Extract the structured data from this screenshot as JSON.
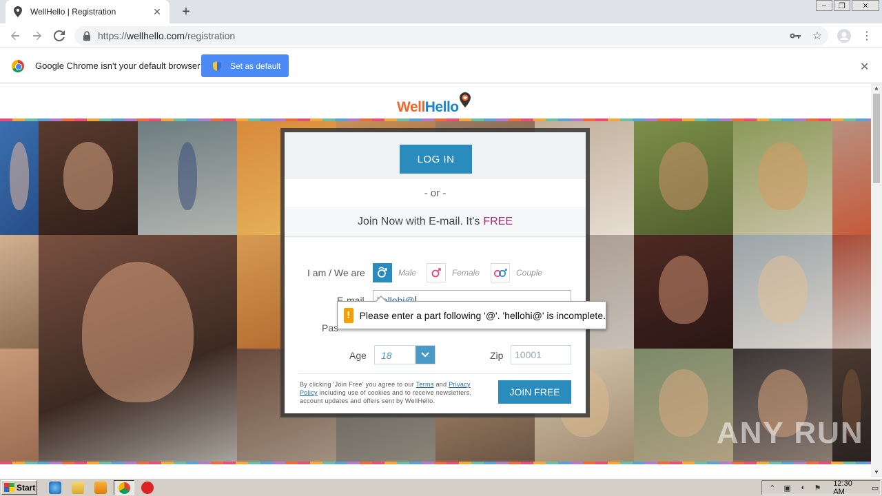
{
  "browser": {
    "tab_title": "WellHello | Registration",
    "new_tab_symbol": "+",
    "url_scheme": "https://",
    "url_host": "wellhello.com",
    "url_path": "/registration"
  },
  "infobar": {
    "message": "Google Chrome isn't your default browser",
    "set_default_label": "Set as default"
  },
  "site": {
    "logo_part1": "Well",
    "logo_part2": "Hello",
    "colors": {
      "accent_blue": "#2a8cbd",
      "free_purple": "#9b2f6f",
      "logo_orange": "#f0662a",
      "logo_blue": "#1a86c8"
    }
  },
  "form": {
    "login_label": "LOG IN",
    "or_label": "- or -",
    "join_title": "Join Now with E-mail. It's",
    "join_free_word": "FREE",
    "i_am_label": "I am / We are",
    "genders": [
      {
        "label": "Male",
        "icon": "male-icon",
        "selected": true
      },
      {
        "label": "Female",
        "icon": "female-icon",
        "selected": false
      },
      {
        "label": "Couple",
        "icon": "couple-icon",
        "selected": false
      }
    ],
    "email_label": "E-mail",
    "email_value": "hellohi@",
    "password_label_visible": "Pas",
    "age_label": "Age",
    "age_value": "18",
    "zip_label": "Zip",
    "zip_placeholder": "10001",
    "terms_prefix": "By clicking 'Join Free' you agree to our",
    "terms_link": "Terms",
    "terms_and": "and",
    "privacy_link": "Privacy Policy",
    "terms_suffix": "including use of cookies and to receive newsletters, account updates and offers sent by WellHello.",
    "join_free_label": "JOIN FREE"
  },
  "validation": {
    "message": "Please enter a part following '@'. 'hellohi@' is incomplete."
  },
  "watermark": "ANY RUN",
  "taskbar": {
    "start_label": "Start",
    "clock": "12:30 AM"
  }
}
